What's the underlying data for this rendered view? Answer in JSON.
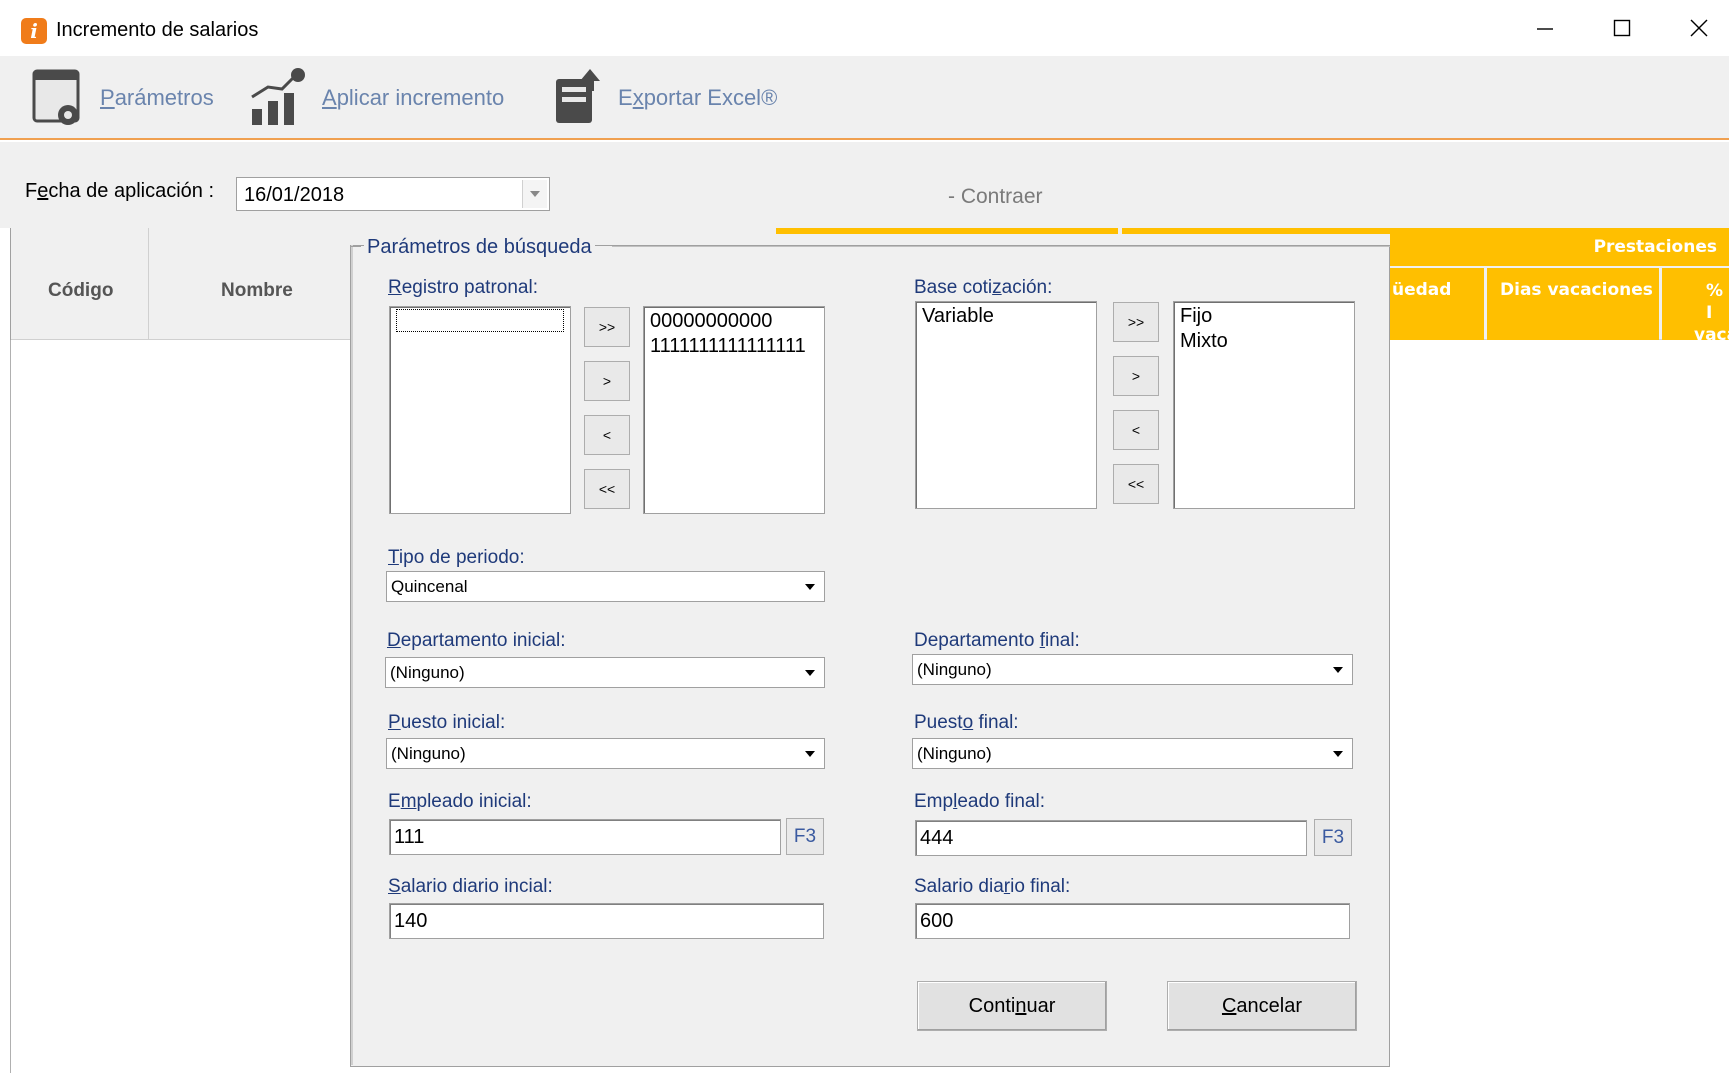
{
  "window": {
    "title": "Incremento de salarios",
    "app_icon_glyph": "i",
    "controls": [
      "minimize-icon",
      "maximize-icon",
      "close-icon"
    ]
  },
  "toolbar": {
    "parametros": "Parámetros",
    "aplicar": "Aplicar incremento",
    "exportar": "Exportar Excel®"
  },
  "filter": {
    "fecha_label": "Fecha de aplicación :",
    "fecha_value": "16/01/2018",
    "contraer": "- Contraer"
  },
  "grid": {
    "headers": {
      "codigo": "Código",
      "nombre": "Nombre",
      "prestaciones": "Prestaciones",
      "antiguedad": "üedad",
      "dias_vacaciones": "Dias vacaciones",
      "pct_line1": "% I",
      "pct_line2": "vaca"
    },
    "accent_color": "#ffbf00"
  },
  "dialog": {
    "group_title": "Parámetros de búsqueda",
    "registro": {
      "label": "Registro patronal:",
      "available": [
        ""
      ],
      "selected": [
        "00000000000",
        "1111111111111111"
      ]
    },
    "base": {
      "label": "Base cotización:",
      "available": [
        "Variable"
      ],
      "selected": [
        "Fijo",
        "Mixto"
      ]
    },
    "move_buttons": {
      "all_right": ">>",
      "right": ">",
      "left": "<",
      "all_left": "<<"
    },
    "tipo_periodo": {
      "label": "Tipo de periodo:",
      "value": "Quincenal"
    },
    "depto_inicial": {
      "label": "Departamento inicial:",
      "value": "(Ninguno)"
    },
    "depto_final": {
      "label": "Departamento final:",
      "value": "(Ninguno)"
    },
    "puesto_inicial": {
      "label": "Puesto inicial:",
      "value": "(Ninguno)"
    },
    "puesto_final": {
      "label": "Puesto final:",
      "value": "(Ninguno)"
    },
    "empleado_inicial": {
      "label": "Empleado inicial:",
      "value": "111"
    },
    "empleado_final": {
      "label": "Empleado final:",
      "value": "444"
    },
    "f3_label": "F3",
    "salario_inicial": {
      "label": "Salario diario incial:",
      "value": "140"
    },
    "salario_final": {
      "label": "Salario diario final:",
      "value": "600"
    },
    "continuar": "Continuar",
    "cancelar": "Cancelar"
  }
}
